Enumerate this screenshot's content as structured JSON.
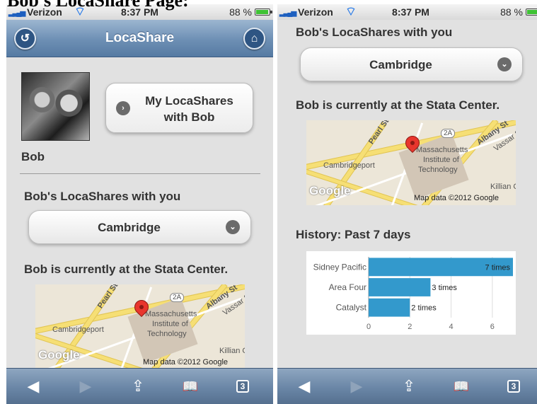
{
  "page_heading": "Bob's LocaShare Page:",
  "status": {
    "carrier": "Verizon",
    "time": "8:37 PM",
    "battery": "88 %"
  },
  "nav": {
    "title": "LocaShare",
    "back_icon": "back-icon",
    "home_icon": "home-icon"
  },
  "profile": {
    "name": "Bob",
    "button_label": "My LocaShares with Bob"
  },
  "locashares": {
    "heading": "Bob's LocaShares with you",
    "selected": "Cambridge"
  },
  "location": {
    "text": "Bob is currently at the Stata Center."
  },
  "map": {
    "street_a": "Pearl St",
    "street_b": "Albany St",
    "street_c": "Vassar St",
    "route": "2A",
    "area": "Cambridgeport",
    "institution_1": "Massachusetts",
    "institution_2": "Institute of",
    "institution_3": "Technology",
    "place": "Killian C",
    "brand": "Google",
    "attribution": "Map data ©2012 Google"
  },
  "history": {
    "heading": "History: Past 7 days"
  },
  "chart_data": {
    "type": "bar",
    "orientation": "horizontal",
    "categories": [
      "Sidney Pacific",
      "Area Four",
      "Catalyst"
    ],
    "values": [
      7,
      3,
      2
    ],
    "data_labels": [
      "7 times",
      "3 times",
      "2 times"
    ],
    "xlim": [
      0,
      7
    ],
    "xticks": [
      0,
      2,
      4,
      6
    ],
    "color": "#3399cc",
    "grid": true
  },
  "toolbar": {
    "back_icon": "◀",
    "forward_icon": "▶",
    "share_icon": "⇪",
    "bookmarks_icon": "📖",
    "tabs_count": "3"
  },
  "colors": {
    "navbar": "#6d8fb4",
    "toolbar": "#6a86a6",
    "bar": "#3399cc",
    "background": "#e1e1e1"
  }
}
